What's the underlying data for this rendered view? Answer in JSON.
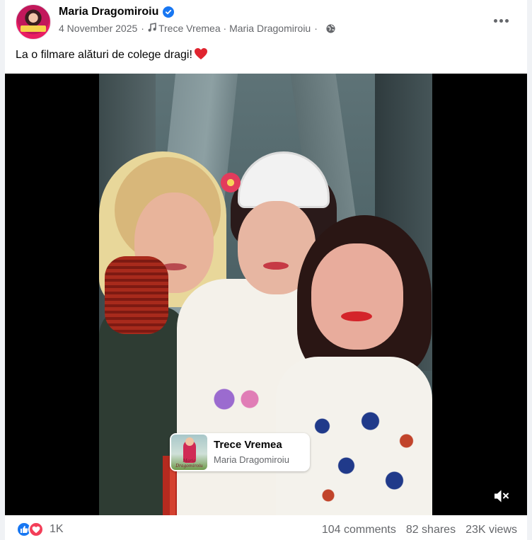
{
  "post": {
    "author": "Maria Dragomiroiu",
    "date": "4 November 2025",
    "song_link": "Trece Vremea · Maria Dragomiroiu",
    "caption": "La o filmare alături de colege dragi!",
    "caption_emoji": "heart"
  },
  "sticker": {
    "song": "Trece Vremea",
    "artist": "Maria Dragomiroiu",
    "album_caption": "Maria Dragomiroiu"
  },
  "footer": {
    "reactions": [
      "like",
      "love"
    ],
    "reaction_count": "1K",
    "comments": "104 comments",
    "shares": "82 shares",
    "views": "23K views"
  },
  "colors": {
    "accent": "#1877f2",
    "love": "#f33e58",
    "secondary_text": "#65676b"
  },
  "icons": [
    "verified-badge-icon",
    "music-note-icon",
    "globe-icon",
    "more-options-icon",
    "mute-icon",
    "like-reaction-icon",
    "love-reaction-icon"
  ]
}
